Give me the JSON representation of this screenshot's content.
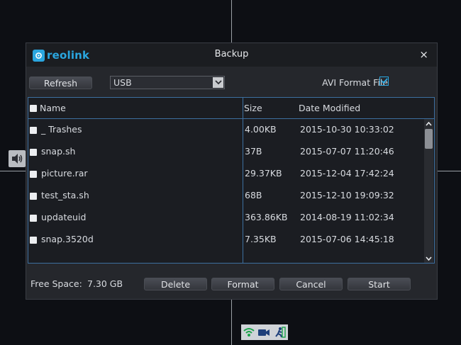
{
  "dialog": {
    "brand": "reolink",
    "title": "Backup",
    "close_glyph": "×"
  },
  "toolbar": {
    "refresh_label": "Refresh",
    "device_selected": "USB",
    "avi_label": "AVI Format File",
    "avi_checked": true
  },
  "table": {
    "headers": {
      "name": "Name",
      "size": "Size",
      "date": "Date Modified"
    },
    "rows": [
      {
        "name": "_ Trashes",
        "size": "4.00KB",
        "date": "2015-10-30 10:33:02"
      },
      {
        "name": "snap.sh",
        "size": "37B",
        "date": "2015-07-07 11:20:46"
      },
      {
        "name": "picture.rar",
        "size": "29.37KB",
        "date": "2015-12-04 17:42:24"
      },
      {
        "name": "test_sta.sh",
        "size": "68B",
        "date": "2015-12-10 19:09:32"
      },
      {
        "name": "updateuid",
        "size": "363.86KB",
        "date": "2014-08-19 11:02:34"
      },
      {
        "name": "snap.3520d",
        "size": "7.35KB",
        "date": "2015-07-06 14:45:18"
      }
    ]
  },
  "footer": {
    "free_space_label": "Free Space:",
    "free_space_value": "7.30 GB",
    "delete_label": "Delete",
    "format_label": "Format",
    "cancel_label": "Cancel",
    "start_label": "Start"
  },
  "icons": {
    "speaker": "speaker-icon",
    "network": "network-icon",
    "record": "record-icon",
    "motion": "motion-icon"
  },
  "colors": {
    "accent": "#2aa6df",
    "border": "#3d6fa0",
    "background": "#0d0f14",
    "dialog": "#25272c"
  }
}
